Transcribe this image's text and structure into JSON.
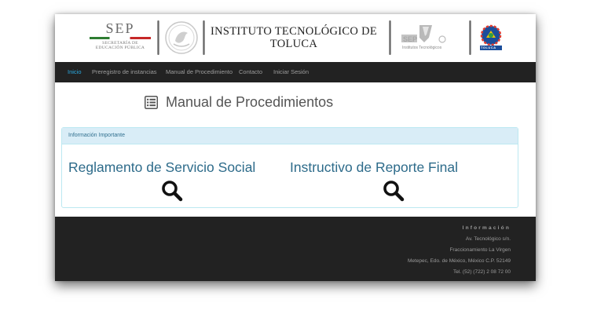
{
  "header": {
    "sep": {
      "big": "SEP",
      "line1": "SECRETARÍA DE",
      "line2": "EDUCACIÓN PÚBLICA"
    },
    "institute_title": "INSTITUTO TECNOLÓGICO DE TOLUCA",
    "tecnm_text": "Institutos Tecnológicos",
    "tecnm_sep": "SEP",
    "toluca_logo_text": "TOLUCA"
  },
  "nav": {
    "items": [
      {
        "label": "Inicio",
        "active": true
      },
      {
        "label": "Preregistro de instancias"
      },
      {
        "label": "Manual de Procedimiento"
      },
      {
        "label": "Contacto"
      },
      {
        "label": "Iniciar Sesión"
      }
    ]
  },
  "main": {
    "title": "Manual de Procedimientos",
    "panel": {
      "heading": "Información Importante",
      "docs": [
        {
          "title": "Reglamento de Servicio Social"
        },
        {
          "title": "Instructivo de Reporte Final"
        }
      ]
    }
  },
  "footer": {
    "heading": "Información",
    "lines": [
      "Av. Tecnológico s/n.",
      "Fraccionamiento La Virgen",
      "Metepec, Edo. de México, México C.P. 52149",
      "Tel. (52) (722) 2 08 72 00"
    ]
  },
  "colors": {
    "nav_bg": "#222222",
    "nav_active": "#2aa9e0",
    "panel_head_bg": "#d9edf7",
    "link": "#2d6b8a",
    "footer_bg": "#222222"
  }
}
